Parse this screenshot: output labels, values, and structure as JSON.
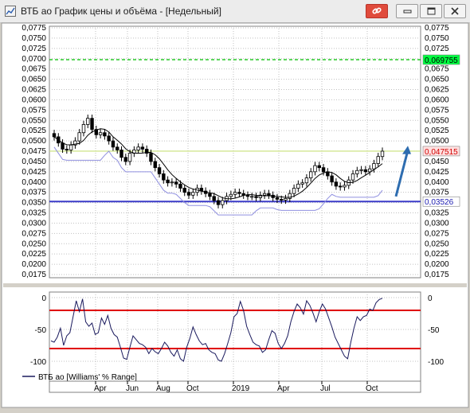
{
  "window": {
    "title": "ВТБ ао График цены и объёма - [Недельный]",
    "buttons": [
      "pin",
      "minimize",
      "maximize",
      "close"
    ],
    "button_icons": {
      "pin": "link-icon",
      "minimize": "minimize-icon",
      "maximize": "maximize-icon",
      "close": "close-icon"
    }
  },
  "colors": {
    "panel_bg": "#ffffff",
    "grid": "#c0c0c0",
    "candle": "#000000",
    "resistance_line": "#00c000",
    "price_line": "#c8e07a",
    "support_line": "#3b3bc8",
    "ma_line": "#000000",
    "lower_band": "#9090e0",
    "osc_line": "#1a1a5e",
    "osc_level": "#e00000",
    "arrow": "#2e6db0"
  },
  "price_axis": {
    "ticks": [
      "0,0775",
      "0,0750",
      "0,0725",
      "0,0700",
      "0,0675",
      "0,0650",
      "0,0625",
      "0,0600",
      "0,0575",
      "0,0550",
      "0,0525",
      "0,0500",
      "0,0475",
      "0,0450",
      "0,0425",
      "0,0400",
      "0,0375",
      "0,0350",
      "0,0325",
      "0,0300",
      "0,0275",
      "0,0250",
      "0,0225",
      "0,0200",
      "0,0175"
    ],
    "ylim": [
      0.0175,
      0.0775
    ]
  },
  "price_labels": {
    "resistance": "0,069755",
    "current": "0,047515",
    "support": "0,03526"
  },
  "osc_axis": {
    "ticks": [
      "0",
      "-50",
      "-100"
    ],
    "ylim": [
      -100,
      0
    ],
    "levels": [
      -20,
      -80
    ]
  },
  "time_axis": {
    "labels": [
      "Apr",
      "Jun",
      "Aug",
      "Oct",
      "2019",
      "Apr",
      "Jul",
      "Oct"
    ]
  },
  "legend": {
    "text": "ВТБ ао [Williams' % Range]"
  },
  "chart_data": [
    {
      "type": "candlestick",
      "ylim": [
        0.0175,
        0.0775
      ],
      "lines": {
        "resistance": 0.069755,
        "current": 0.047515,
        "support": 0.03526
      },
      "closes": [
        0.051,
        0.0495,
        0.048,
        0.0478,
        0.049,
        0.05,
        0.052,
        0.054,
        0.0555,
        0.0528,
        0.0515,
        0.052,
        0.0512,
        0.05,
        0.0485,
        0.0478,
        0.046,
        0.045,
        0.047,
        0.0478,
        0.0485,
        0.048,
        0.047,
        0.045,
        0.0435,
        0.042,
        0.0405,
        0.0398,
        0.04,
        0.0395,
        0.0385,
        0.0375,
        0.0368,
        0.0375,
        0.0385,
        0.0378,
        0.0372,
        0.0365,
        0.0355,
        0.0345,
        0.0355,
        0.0365,
        0.037,
        0.0375,
        0.0372,
        0.0368,
        0.0365,
        0.0365,
        0.0362,
        0.0368,
        0.0372,
        0.0368,
        0.0362,
        0.0358,
        0.0356,
        0.036,
        0.0372,
        0.0385,
        0.0395,
        0.0398,
        0.041,
        0.0425,
        0.044,
        0.0435,
        0.0425,
        0.0415,
        0.04,
        0.039,
        0.0388,
        0.0392,
        0.0405,
        0.042,
        0.0428,
        0.043,
        0.0425,
        0.0432,
        0.0445,
        0.0462,
        0.0475
      ]
    },
    {
      "type": "line",
      "name": "ВТБ ао [Williams' % Range]",
      "ylim": [
        -100,
        0
      ],
      "values": [
        -68,
        -70,
        -62,
        -48,
        -75,
        -60,
        -55,
        -30,
        -5,
        -22,
        -2,
        -38,
        -45,
        -40,
        -58,
        -55,
        -32,
        -42,
        -28,
        -48,
        -58,
        -62,
        -78,
        -95,
        -97,
        -78,
        -60,
        -66,
        -72,
        -74,
        -78,
        -88,
        -80,
        -85,
        -88,
        -80,
        -70,
        -76,
        -86,
        -92,
        -82,
        -96,
        -100,
        -78,
        -64,
        -46,
        -58,
        -68,
        -74,
        -72,
        -82,
        -86,
        -88,
        -98,
        -100,
        -88,
        -72,
        -55,
        -30,
        -25,
        -6,
        -20,
        -45,
        -58,
        -70,
        -74,
        -76,
        -86,
        -82,
        -66,
        -52,
        -56,
        -72,
        -80,
        -72,
        -60,
        -38,
        -22,
        -10,
        -16,
        -26,
        -5,
        -12,
        -24,
        -38,
        -22,
        -10,
        -18,
        -32,
        -46,
        -62,
        -72,
        -82,
        -92,
        -96,
        -70,
        -48,
        -30,
        -36,
        -30,
        -28,
        -18,
        -20,
        -8,
        -3,
        -1
      ]
    }
  ]
}
